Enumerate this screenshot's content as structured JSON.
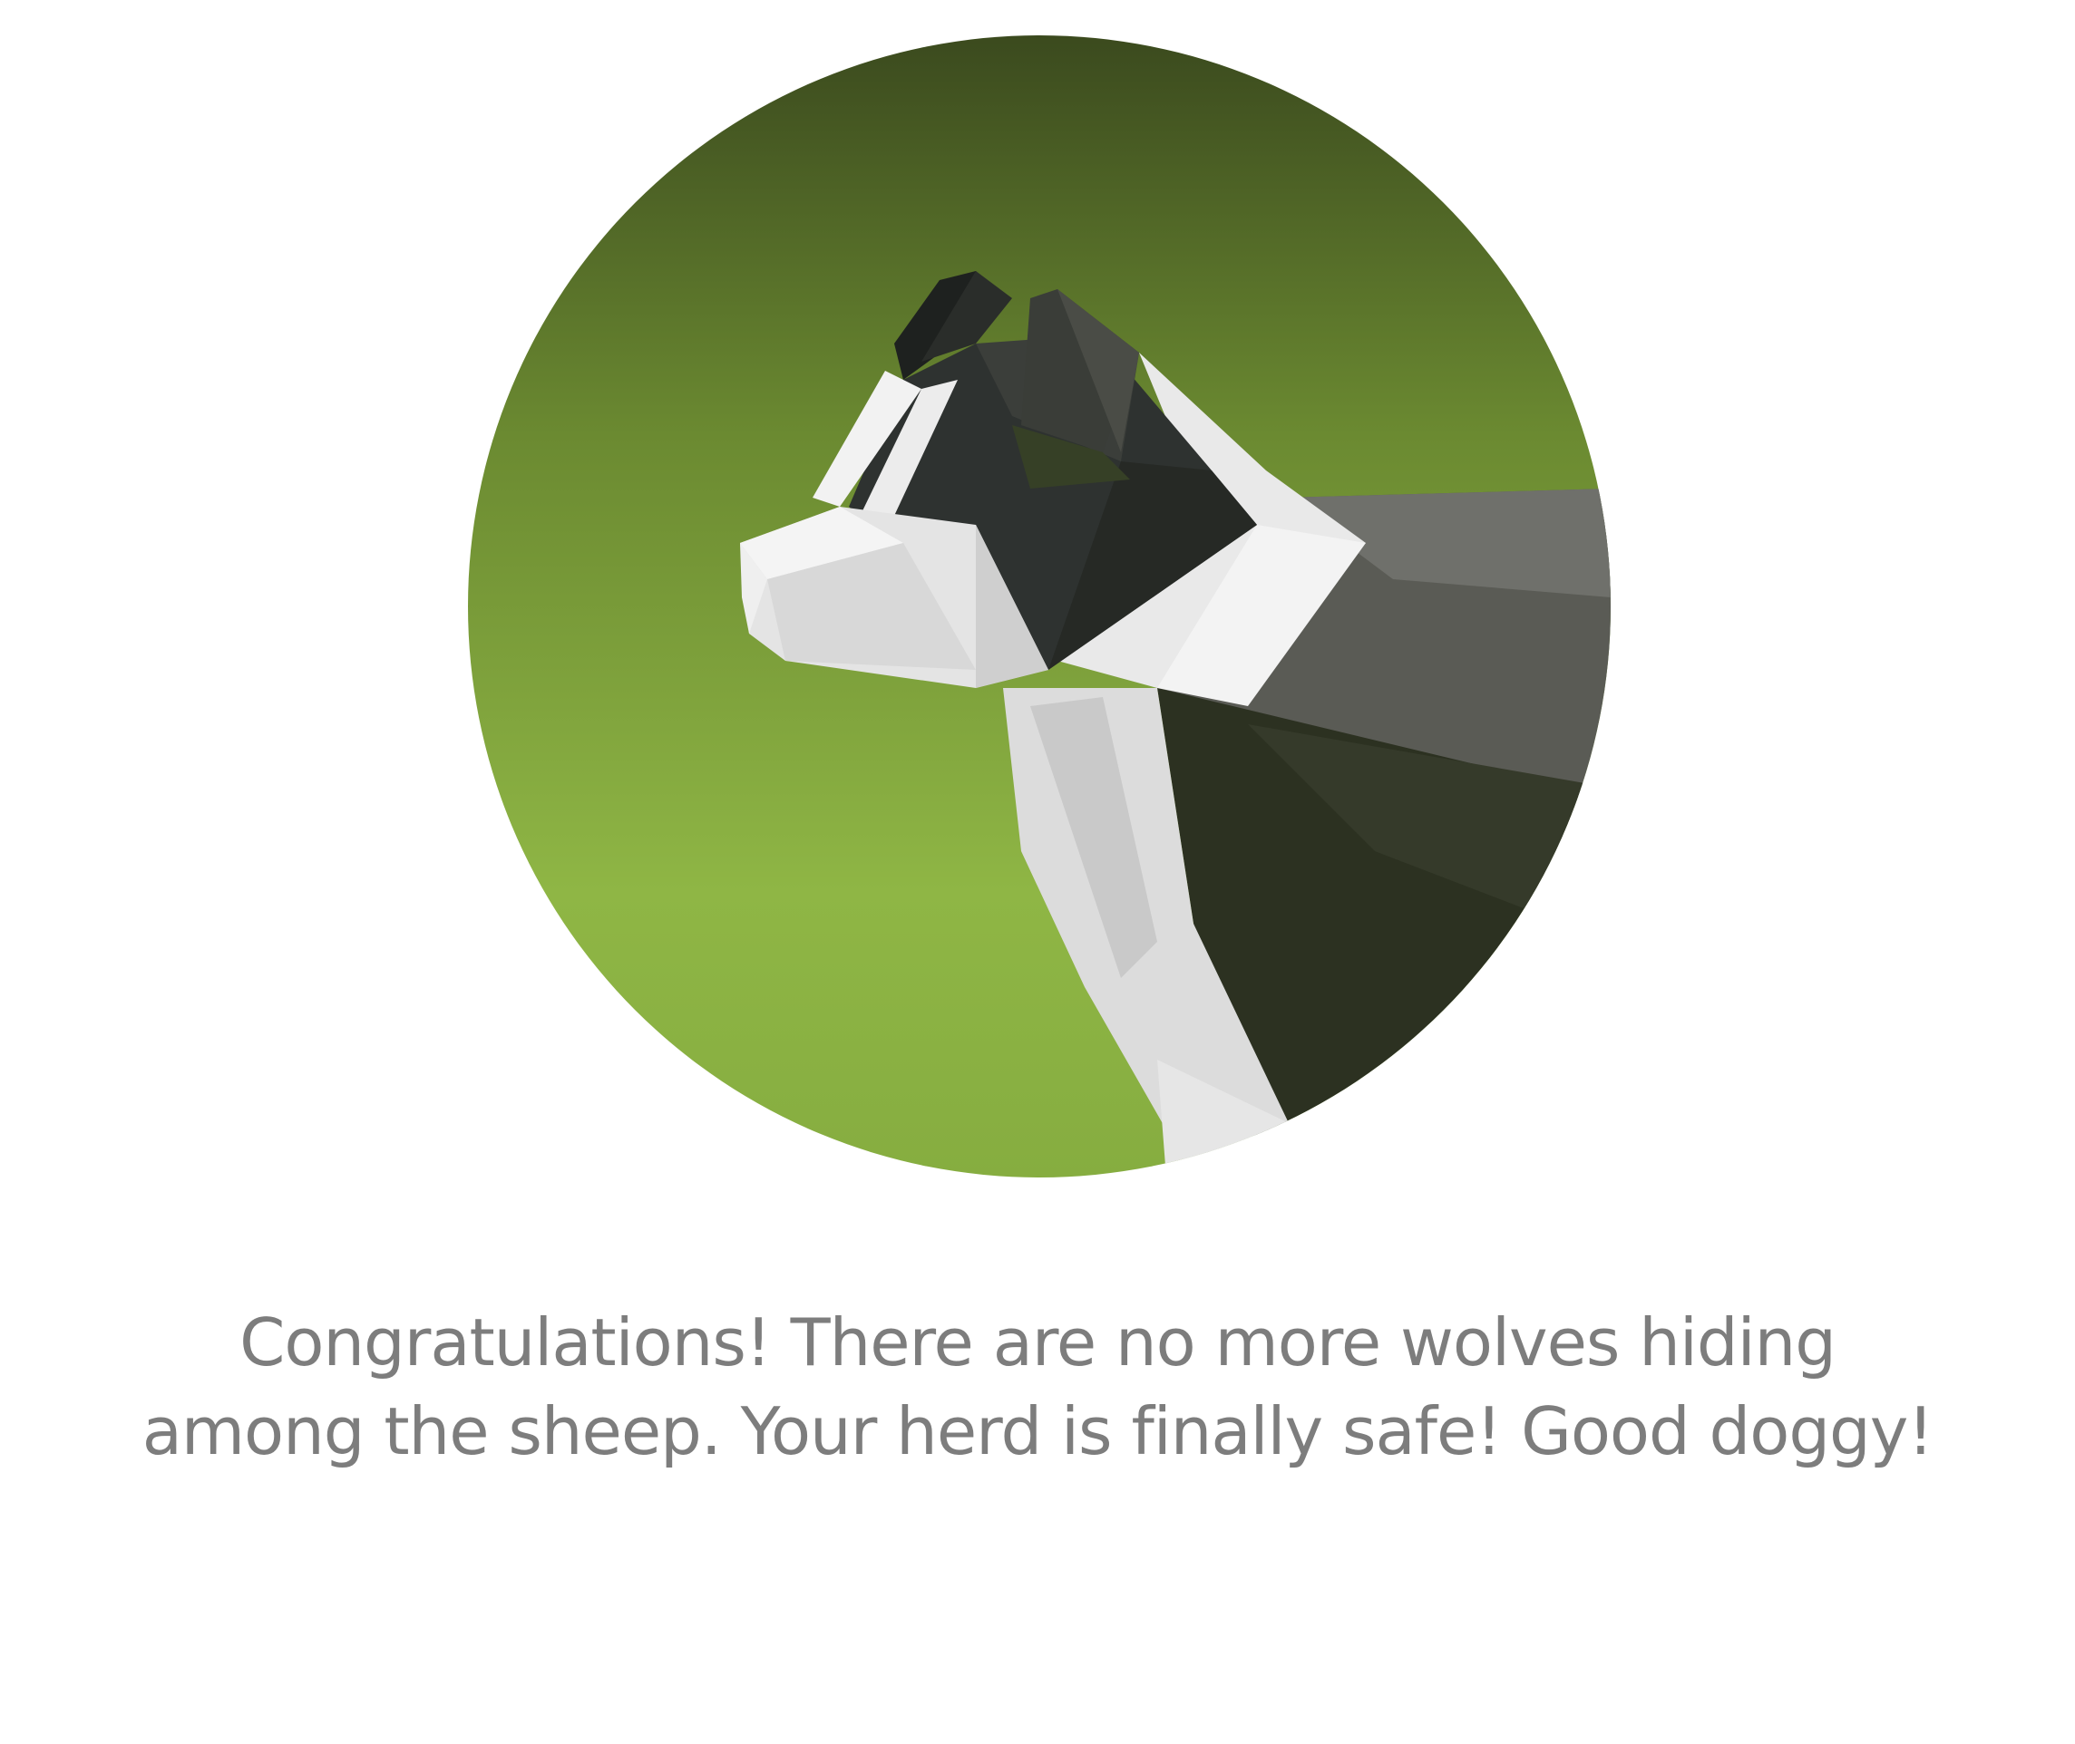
{
  "victory_screen": {
    "illustration": {
      "subject": "low-poly-border-collie-profile",
      "background_gradient": [
        "#3d4f1f",
        "#6e8f33",
        "#8db845"
      ],
      "fur_colors": {
        "dark": "#2d3128",
        "mid": "#4b4d47",
        "light_grey": "#6f706b",
        "white": "#eeeeee"
      }
    },
    "message": {
      "line_1": "Congratulations! There are no more wolves hiding",
      "line_2": "among the sheep. Your herd is finally safe! Good doggy!"
    },
    "colors": {
      "text": "#7d7d7d",
      "page_background": "#ffffff"
    }
  }
}
